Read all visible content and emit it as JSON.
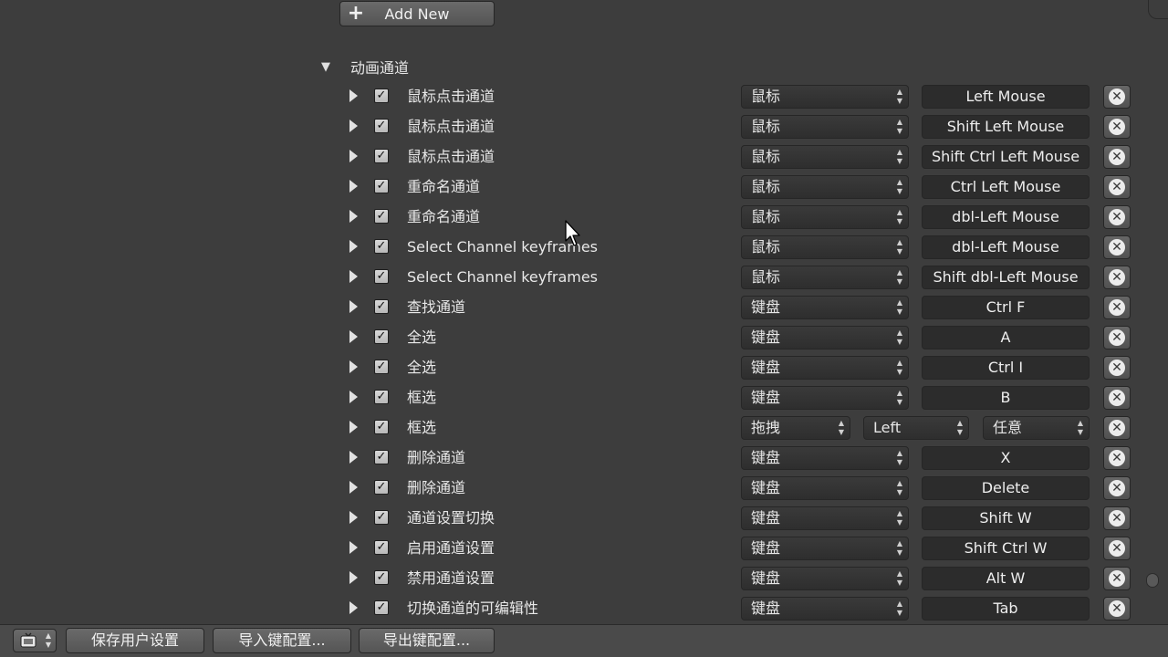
{
  "add_new_label": "Add New",
  "section_title": "动画通道",
  "rows": [
    {
      "name": "鼠标点击通道",
      "type": "鼠标",
      "key": "Left Mouse"
    },
    {
      "name": "鼠标点击通道",
      "type": "鼠标",
      "key": "Shift Left Mouse"
    },
    {
      "name": "鼠标点击通道",
      "type": "鼠标",
      "key": "Shift Ctrl Left Mouse"
    },
    {
      "name": "重命名通道",
      "type": "鼠标",
      "key": "Ctrl Left Mouse"
    },
    {
      "name": "重命名通道",
      "type": "鼠标",
      "key": "dbl-Left Mouse"
    },
    {
      "name": "Select Channel keyframes",
      "type": "鼠标",
      "key": "dbl-Left Mouse"
    },
    {
      "name": "Select Channel keyframes",
      "type": "鼠标",
      "key": "Shift dbl-Left Mouse"
    },
    {
      "name": "查找通道",
      "type": "键盘",
      "key": "Ctrl F"
    },
    {
      "name": "全选",
      "type": "键盘",
      "key": "A"
    },
    {
      "name": "全选",
      "type": "键盘",
      "key": "Ctrl I"
    },
    {
      "name": "框选",
      "type": "键盘",
      "key": "B"
    },
    {
      "name": "框选",
      "type": "拖拽",
      "mouse": "Left",
      "modifier": "任意"
    },
    {
      "name": "删除通道",
      "type": "键盘",
      "key": "X"
    },
    {
      "name": "删除通道",
      "type": "键盘",
      "key": "Delete"
    },
    {
      "name": "通道设置切换",
      "type": "键盘",
      "key": "Shift W"
    },
    {
      "name": "启用通道设置",
      "type": "键盘",
      "key": "Shift Ctrl W"
    },
    {
      "name": "禁用通道设置",
      "type": "键盘",
      "key": "Alt W"
    },
    {
      "name": "切换通道的可编辑性",
      "type": "键盘",
      "key": "Tab"
    }
  ],
  "bottom_bar": {
    "save_label": "保存用户设置",
    "import_label": "导入键配置...",
    "export_label": "导出键配置..."
  },
  "colors": {
    "background": "#3d3d3d",
    "field": "#2c2c2c",
    "button": "#5e5e5e"
  },
  "icons": {
    "expand": "disclosure-triangle-right-icon",
    "checked": "checkmark-icon",
    "remove": "close-circle-icon",
    "add": "plus-icon",
    "editor": "user-preferences-icon",
    "cursor": "mouse-pointer-icon"
  }
}
